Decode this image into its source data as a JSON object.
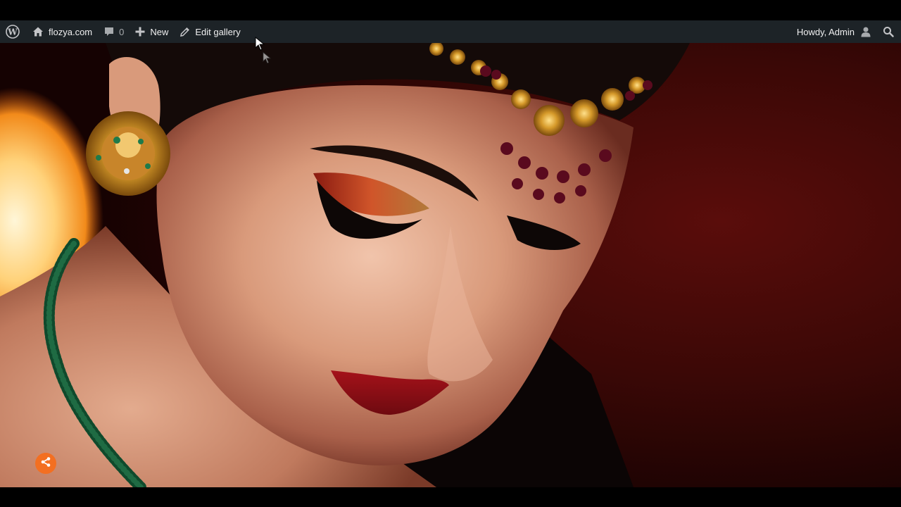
{
  "admin_bar": {
    "wp_logo_icon": "wordpress-logo-icon",
    "site_icon": "home-icon",
    "site_name": "flozya.com",
    "comments_icon": "comment-bubble-icon",
    "comments_count": "0",
    "new_icon": "plus-icon",
    "new_label": "New",
    "edit_icon": "pencil-icon",
    "edit_label": "Edit gallery",
    "greeting": "Howdy, Admin",
    "avatar_icon": "user-avatar-icon",
    "search_icon": "search-icon",
    "background_color": "#1d2327"
  },
  "hero": {
    "image_icon": "portrait-photo",
    "share_icon": "share-icon",
    "share_color": "#f36f21"
  }
}
